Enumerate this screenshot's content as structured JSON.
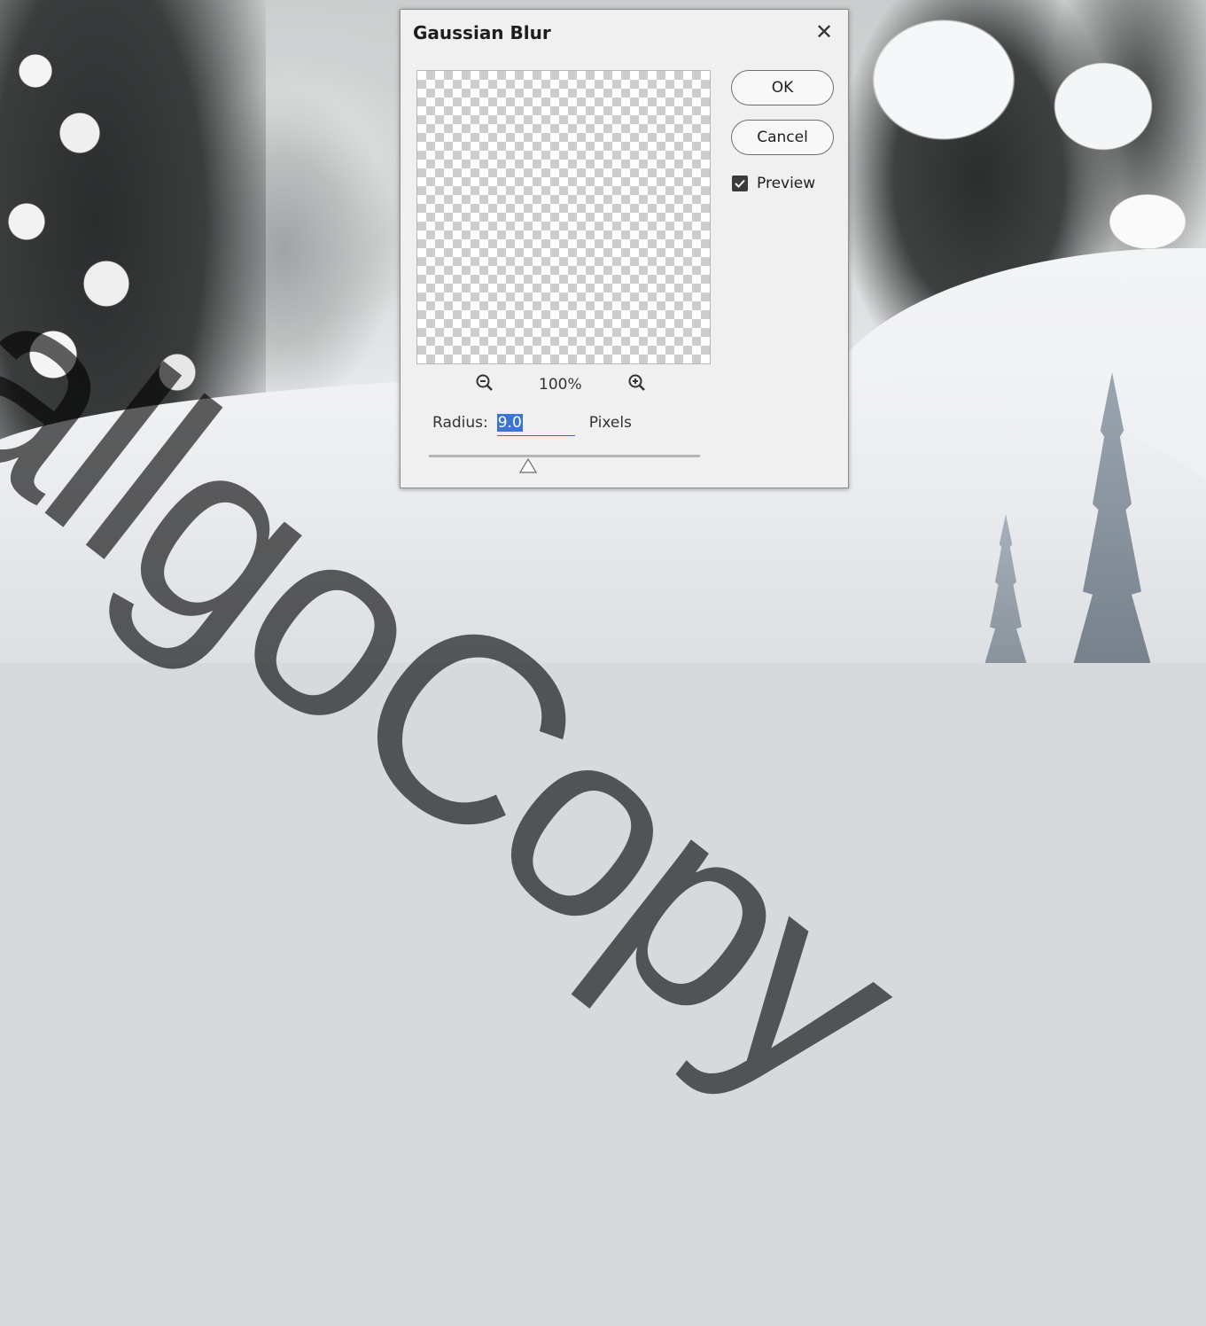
{
  "dialog": {
    "title": "Gaussian Blur",
    "close_icon": "close-icon",
    "ok_label": "OK",
    "cancel_label": "Cancel",
    "preview_label": "Preview",
    "preview_checked": true,
    "zoom_level": "100%",
    "radius_label": "Radius:",
    "radius_value": "9.0",
    "radius_units": "Pixels",
    "radius_value_selected": true
  },
  "watermark": "allgoCopy",
  "colors": {
    "dialog_bg": "#f0f0f0",
    "selection": "#3b74d7",
    "checkbox": "#3b3b3b"
  }
}
